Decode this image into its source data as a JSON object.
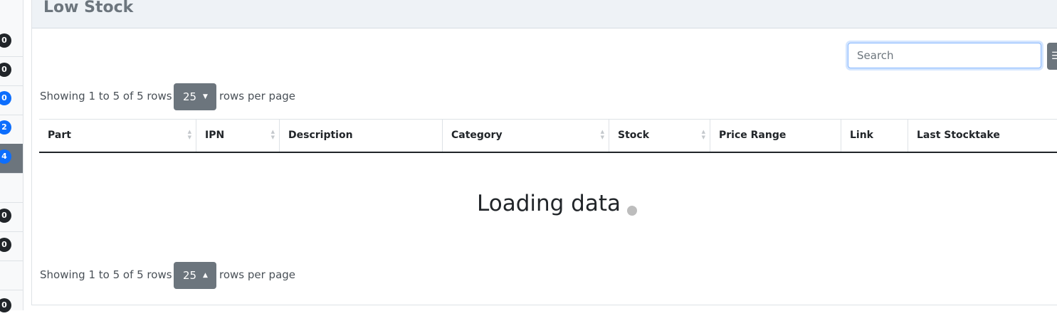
{
  "sidebar": {
    "badges": [
      {
        "value": "0",
        "color": "#212529"
      },
      {
        "value": "0",
        "color": "#212529"
      },
      {
        "value": "0",
        "color": "#0d6efd"
      },
      {
        "value": "2",
        "color": "#0d6efd"
      },
      {
        "value": "4",
        "color": "#0d6efd"
      },
      {
        "value": "0",
        "color": "#212529"
      },
      {
        "value": "0",
        "color": "#212529"
      },
      {
        "value": "0",
        "color": "#212529"
      }
    ]
  },
  "panel": {
    "title": "Low Stock",
    "search": {
      "placeholder": "Search"
    },
    "toolbar_icon": "list-icon",
    "pagination_top": {
      "summary": "Showing 1 to 5 of 5 rows",
      "page_size": "25",
      "suffix": "rows per page"
    },
    "pagination_bottom": {
      "summary": "Showing 1 to 5 of 5 rows",
      "page_size": "25",
      "suffix": "rows per page"
    },
    "columns": [
      {
        "label": "Part",
        "sortable": true
      },
      {
        "label": "IPN",
        "sortable": true
      },
      {
        "label": "Description",
        "sortable": false
      },
      {
        "label": "Category",
        "sortable": true
      },
      {
        "label": "Stock",
        "sortable": true
      },
      {
        "label": "Price Range",
        "sortable": false
      },
      {
        "label": "Link",
        "sortable": false
      },
      {
        "label": "Last Stocktake",
        "sortable": false
      }
    ],
    "loading_text": "Loading data ."
  }
}
